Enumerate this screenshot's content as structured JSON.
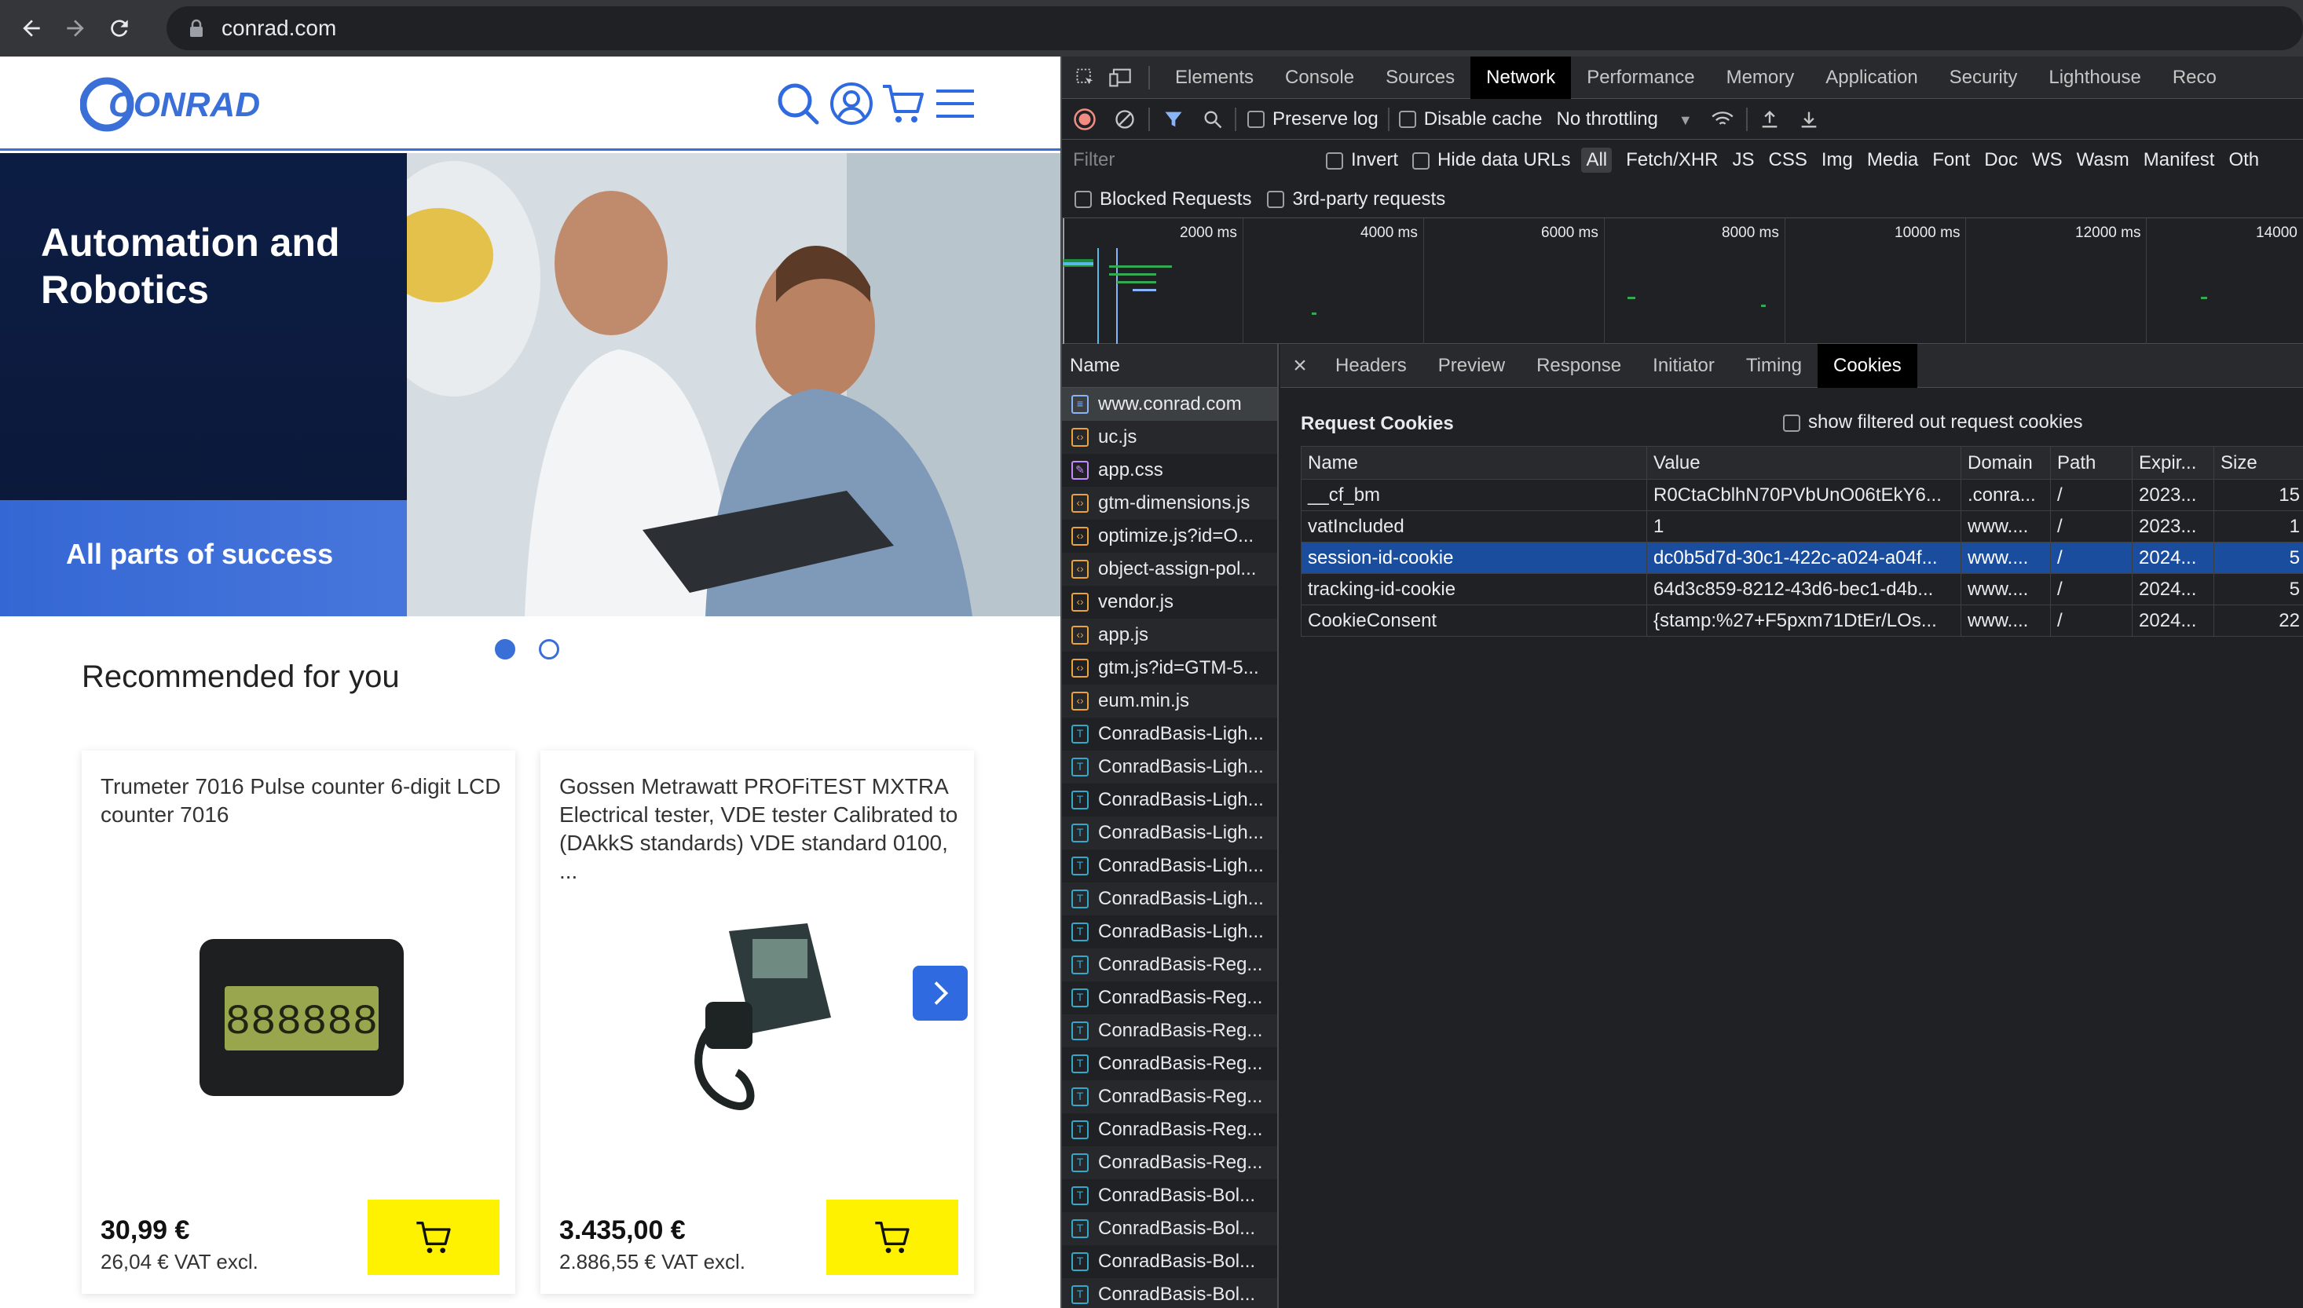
{
  "browser": {
    "url": "conrad.com"
  },
  "site": {
    "logo_text": "CONRAD",
    "hero": {
      "title": "Automation and Robotics",
      "subtitle": "All parts of success"
    },
    "recommended_title": "Recommended for you",
    "products": [
      {
        "name": "Trumeter 7016 Pulse counter 6-digit LCD counter 7016",
        "price": "30,99 €",
        "vat": "26,04 € VAT excl."
      },
      {
        "name": "Gossen Metrawatt PROFiTEST MXTRA Electrical tester, VDE tester Calibrated to (DAkkS standards) VDE standard 0100, ...",
        "price": "3.435,00 €",
        "vat": "2.886,55 € VAT excl."
      }
    ]
  },
  "devtools": {
    "tabs": [
      "Elements",
      "Console",
      "Sources",
      "Network",
      "Performance",
      "Memory",
      "Application",
      "Security",
      "Lighthouse",
      "Reco"
    ],
    "active_tab": "Network",
    "toolbar": {
      "preserve_log": "Preserve log",
      "disable_cache": "Disable cache",
      "throttling": "No throttling"
    },
    "filter": {
      "placeholder": "Filter",
      "invert": "Invert",
      "hide_data_urls": "Hide data URLs",
      "types": [
        "All",
        "Fetch/XHR",
        "JS",
        "CSS",
        "Img",
        "Media",
        "Font",
        "Doc",
        "WS",
        "Wasm",
        "Manifest",
        "Oth"
      ],
      "blocked_requests": "Blocked Requests",
      "third_party": "3rd-party requests"
    },
    "timeline_labels": [
      "2000 ms",
      "4000 ms",
      "6000 ms",
      "8000 ms",
      "10000 ms",
      "12000 ms",
      "14000"
    ],
    "request_list": {
      "header": "Name",
      "items": [
        {
          "name": "www.conrad.com",
          "type": "doc"
        },
        {
          "name": "uc.js",
          "type": "js"
        },
        {
          "name": "app.css",
          "type": "css"
        },
        {
          "name": "gtm-dimensions.js",
          "type": "js"
        },
        {
          "name": "optimize.js?id=O...",
          "type": "js"
        },
        {
          "name": "object-assign-pol...",
          "type": "js"
        },
        {
          "name": "vendor.js",
          "type": "js"
        },
        {
          "name": "app.js",
          "type": "js"
        },
        {
          "name": "gtm.js?id=GTM-5...",
          "type": "js"
        },
        {
          "name": "eum.min.js",
          "type": "js"
        },
        {
          "name": "ConradBasis-Ligh...",
          "type": "font"
        },
        {
          "name": "ConradBasis-Ligh...",
          "type": "font"
        },
        {
          "name": "ConradBasis-Ligh...",
          "type": "font"
        },
        {
          "name": "ConradBasis-Ligh...",
          "type": "font"
        },
        {
          "name": "ConradBasis-Ligh...",
          "type": "font"
        },
        {
          "name": "ConradBasis-Ligh...",
          "type": "font"
        },
        {
          "name": "ConradBasis-Ligh...",
          "type": "font"
        },
        {
          "name": "ConradBasis-Reg...",
          "type": "font"
        },
        {
          "name": "ConradBasis-Reg...",
          "type": "font"
        },
        {
          "name": "ConradBasis-Reg...",
          "type": "font"
        },
        {
          "name": "ConradBasis-Reg...",
          "type": "font"
        },
        {
          "name": "ConradBasis-Reg...",
          "type": "font"
        },
        {
          "name": "ConradBasis-Reg...",
          "type": "font"
        },
        {
          "name": "ConradBasis-Reg...",
          "type": "font"
        },
        {
          "name": "ConradBasis-Bol...",
          "type": "font"
        },
        {
          "name": "ConradBasis-Bol...",
          "type": "font"
        },
        {
          "name": "ConradBasis-Bol...",
          "type": "font"
        },
        {
          "name": "ConradBasis-Bol...",
          "type": "font"
        }
      ]
    },
    "detail_tabs": [
      "Headers",
      "Preview",
      "Response",
      "Initiator",
      "Timing",
      "Cookies"
    ],
    "active_detail_tab": "Cookies",
    "cookies": {
      "title": "Request Cookies",
      "show_filtered": "show filtered out request cookies",
      "columns": [
        "Name",
        "Value",
        "Domain",
        "Path",
        "Expir...",
        "Size"
      ],
      "rows": [
        {
          "name": "__cf_bm",
          "value": "R0CtaCblhN70PVbUnO06tEkY6...",
          "domain": ".conra...",
          "path": "/",
          "expires": "2023...",
          "size": "15"
        },
        {
          "name": "vatIncluded",
          "value": "1",
          "domain": "www....",
          "path": "/",
          "expires": "2023...",
          "size": "1"
        },
        {
          "name": "session-id-cookie",
          "value": "dc0b5d7d-30c1-422c-a024-a04f...",
          "domain": "www....",
          "path": "/",
          "expires": "2024...",
          "size": "5"
        },
        {
          "name": "tracking-id-cookie",
          "value": "64d3c859-8212-43d6-bec1-d4b...",
          "domain": "www....",
          "path": "/",
          "expires": "2024...",
          "size": "5"
        },
        {
          "name": "CookieConsent",
          "value": "{stamp:%27+F5pxm71DtEr/LOs...",
          "domain": "www....",
          "path": "/",
          "expires": "2024...",
          "size": "22"
        }
      ],
      "selected_row": 2
    }
  }
}
